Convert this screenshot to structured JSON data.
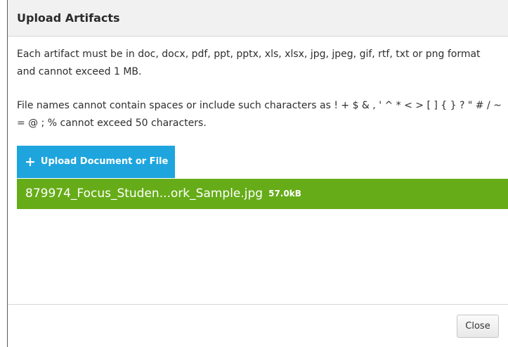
{
  "dialog": {
    "title": "Upload Artifacts",
    "instructions": [
      "Each artifact must be in doc, docx, pdf, ppt, pptx, xls, xlsx, jpg, jpeg, gif, rtf, txt or png format and cannot exceed 1 MB.",
      "File names cannot contain spaces or include such characters as ! + $ & , ' ^ * < > [ ] { } ? \" # / ~ = @ ; % cannot exceed 50 characters."
    ],
    "upload_button": {
      "icon": "plus-icon",
      "label": "Upload Document or File",
      "color": "#1ea5de"
    },
    "files": [
      {
        "name": "879974_Focus_Studen...ork_Sample.jpg",
        "size": "57.0kB",
        "color": "#66ac18"
      }
    ],
    "close_label": "Close"
  }
}
